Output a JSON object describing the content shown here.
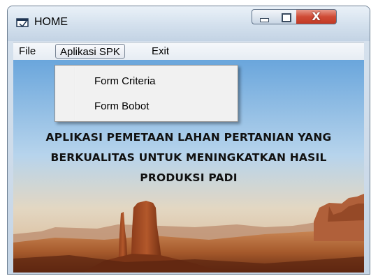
{
  "window": {
    "title": "HOME",
    "controls": {
      "minimize_icon": "minimize-icon",
      "maximize_icon": "maximize-icon",
      "close_glyph": "X"
    }
  },
  "menubar": {
    "items": [
      {
        "label": "File"
      },
      {
        "label": "Aplikasi SPK"
      },
      {
        "label": "Exit"
      }
    ]
  },
  "dropdown": {
    "items": [
      {
        "label": "Form Criteria"
      },
      {
        "label": "Form Bobot"
      }
    ]
  },
  "main": {
    "heading_lines": [
      "APLIKASI PEMETAAN LAHAN PERTANIAN YANG",
      "BERKUALITAS UNTUK MENINGKATKAN HASIL",
      "PRODUKSI PADI"
    ]
  },
  "colors": {
    "close_button": "#c23a25",
    "title_bar": "#d3e0ed"
  }
}
